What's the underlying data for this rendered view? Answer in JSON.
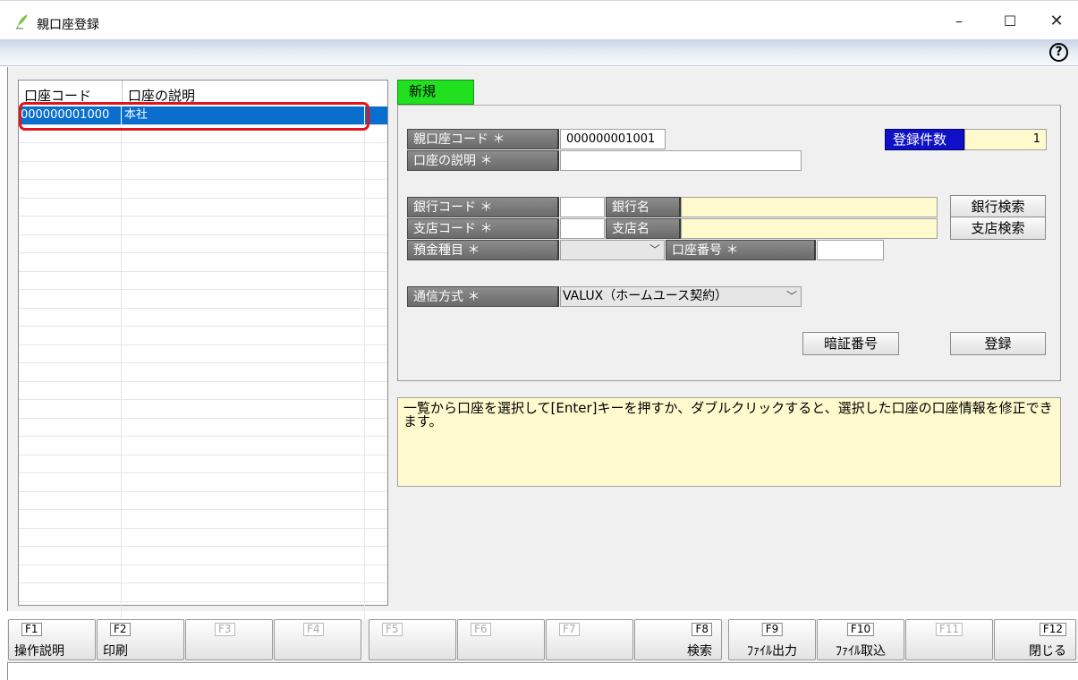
{
  "window": {
    "title": "親口座登録",
    "controls": {
      "minimize": "–",
      "maximize": "☐",
      "close": "✕"
    }
  },
  "toolbar": {
    "help": "?"
  },
  "list": {
    "headers": [
      "口座コード",
      "口座の説明"
    ],
    "rows": [
      {
        "code": "000000001000",
        "description": "本社",
        "selected": true
      }
    ]
  },
  "tab": {
    "label": "新規"
  },
  "form": {
    "parent_code_label": "親口座コード ＊",
    "parent_code_value": "000000001001",
    "account_desc_label": "口座の説明 ＊",
    "account_desc_value": "",
    "count_label": "登録件数",
    "count_value": "1",
    "bank_code_label": "銀行コード ＊",
    "bank_name_label": "銀行名",
    "bank_search_button": "銀行検索",
    "branch_code_label": "支店コード ＊",
    "branch_name_label": "支店名",
    "branch_search_button": "支店検索",
    "deposit_type_label": "預金種目 ＊",
    "account_number_label": "口座番号 ＊",
    "comm_method_label": "通信方式 ＊",
    "comm_method_value": "VALUX（ホームユース契約）",
    "pin_button": "暗証番号",
    "register_button": "登録"
  },
  "message": "一覧から口座を選択して[Enter]キーを押すか、ダブルクリックすると、選択した口座の口座情報を修正できます。",
  "function_keys": [
    {
      "key": "F1",
      "label": "操作説明",
      "enabled": true
    },
    {
      "key": "F2",
      "label": "印刷",
      "enabled": true
    },
    {
      "key": "F3",
      "label": "",
      "enabled": false
    },
    {
      "key": "F4",
      "label": "",
      "enabled": false
    },
    {
      "key": "F5",
      "label": "",
      "enabled": false
    },
    {
      "key": "F6",
      "label": "",
      "enabled": false
    },
    {
      "key": "F7",
      "label": "",
      "enabled": false
    },
    {
      "key": "F8",
      "label": "検索",
      "enabled": true
    },
    {
      "key": "F9",
      "label": "ﾌｧｲﾙ出力",
      "enabled": true
    },
    {
      "key": "F10",
      "label": "ﾌｧｲﾙ取込",
      "enabled": true
    },
    {
      "key": "F11",
      "label": "",
      "enabled": false
    },
    {
      "key": "F12",
      "label": "閉じる",
      "enabled": true
    }
  ],
  "colors": {
    "selection": "#0a6ecf",
    "highlight_box": "#e0141a",
    "tab_green": "#20e020",
    "count_label_blue": "#1010c8",
    "field_yellow": "#fffacd"
  }
}
